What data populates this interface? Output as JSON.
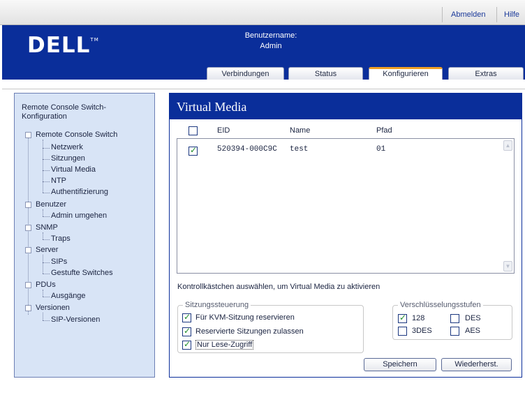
{
  "topbar": {
    "logout": "Abmelden",
    "help": "Hilfe"
  },
  "header": {
    "logo": "DELL",
    "logo_tm": "TM",
    "user_caption": "Benutzername:",
    "user_name": "Admin"
  },
  "tabs": [
    {
      "label": "Verbindungen",
      "active": false
    },
    {
      "label": "Status",
      "active": false
    },
    {
      "label": "Konfigurieren",
      "active": true
    },
    {
      "label": "Extras",
      "active": false
    }
  ],
  "tree": {
    "title": "Remote Console Switch-Konfiguration",
    "groups": [
      {
        "label": "Remote Console Switch",
        "children": [
          "Netzwerk",
          "Sitzungen",
          "Virtual Media",
          "NTP",
          "Authentifizierung"
        ]
      },
      {
        "label": "Benutzer",
        "children": [
          "Admin umgehen"
        ]
      },
      {
        "label": "SNMP",
        "children": [
          "Traps"
        ]
      },
      {
        "label": "Server",
        "children": [
          "SIPs",
          "Gestufte Switches"
        ]
      },
      {
        "label": "PDUs",
        "children": [
          "Ausgänge"
        ]
      },
      {
        "label": "Versionen",
        "children": [
          "SIP-Versionen"
        ]
      }
    ]
  },
  "virtual_media": {
    "title": "Virtual Media",
    "columns": {
      "eid": "EID",
      "name": "Name",
      "path": "Pfad"
    },
    "select_all_checked": false,
    "rows": [
      {
        "checked": true,
        "eid": "520394-000C9C",
        "name": "test",
        "path": "01"
      }
    ],
    "instruction": "Kontrollkästchen auswählen, um Virtual Media zu aktivieren"
  },
  "session_control": {
    "legend": "Sitzungssteuerung",
    "options": [
      {
        "label": "Für KVM-Sitzung reservieren",
        "checked": true
      },
      {
        "label": "Reservierte Sitzungen zulassen",
        "checked": true
      },
      {
        "label": "Nur Lese-Zugriff",
        "checked": true
      }
    ]
  },
  "encryption": {
    "legend": "Verschlüsselungsstufen",
    "options": [
      {
        "label": "128",
        "checked": true
      },
      {
        "label": "DES",
        "checked": false
      },
      {
        "label": "3DES",
        "checked": false
      },
      {
        "label": "AES",
        "checked": false
      }
    ]
  },
  "buttons": {
    "save": "Speichern",
    "reset": "Wiederherst."
  },
  "colors": {
    "brand_blue": "#0a2e9a",
    "active_tab_accent": "#f0a024",
    "tree_background": "#d8e4f6",
    "check_green": "#1f8c2a"
  }
}
